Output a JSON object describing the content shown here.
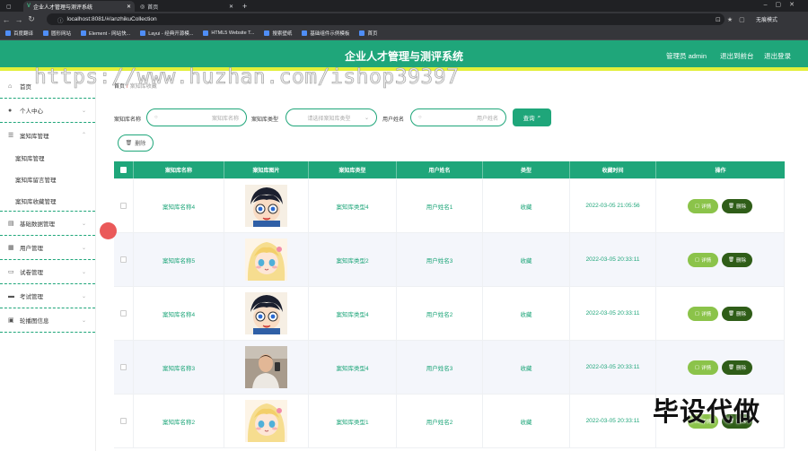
{
  "browser": {
    "tabs": [
      {
        "title": "企业人才管理与测评系统",
        "active": true
      },
      {
        "title": "首页",
        "active": false
      }
    ],
    "url": "localhost:8081/#/anzhikuCollection",
    "bookmarks": [
      "百度翻译",
      "圆形网站",
      "Element - 网站快...",
      "Layui - 经典开源模...",
      "HTML5 Website T...",
      "搜索壁纸",
      "基础组件示例模板",
      "首页"
    ],
    "profile": "无痕模式"
  },
  "header": {
    "title": "企业人才管理与测评系统",
    "user": "管理员 admin",
    "back_link": "退出到前台",
    "logout": "退出登录"
  },
  "sidebar": {
    "items": [
      {
        "icon": "home-icon",
        "label": "首页"
      },
      {
        "icon": "person-icon",
        "label": "个人中心"
      },
      {
        "icon": "list-icon",
        "label": "案知库管理"
      }
    ],
    "sub_items": [
      "案知库管理",
      "案知库留言管理",
      "案知库收藏管理"
    ],
    "items_after": [
      {
        "icon": "data-icon",
        "label": "基础数据管理"
      },
      {
        "icon": "user-icon",
        "label": "用户管理"
      },
      {
        "icon": "paper-icon",
        "label": "试卷管理"
      },
      {
        "icon": "exam-icon",
        "label": "考试管理"
      },
      {
        "icon": "image-icon",
        "label": "轮播图信息"
      }
    ]
  },
  "breadcrumb": {
    "home": "首页",
    "sep": "/",
    "current": "案知库收藏"
  },
  "search": {
    "name_label": "案知库名称",
    "name_placeholder": "案知库名称",
    "type_label": "案知库类型",
    "type_placeholder": "请选择案知库类型",
    "user_label": "用户姓名",
    "user_placeholder": "用户姓名",
    "query_button": "查询"
  },
  "batch_delete": "删除",
  "table": {
    "headers": [
      "案知库名称",
      "案知库图片",
      "案知库类型",
      "用户姓名",
      "类型",
      "收藏时间",
      "操作"
    ],
    "rows": [
      {
        "name": "案知库名称4",
        "type": "案知库类型4",
        "user": "用户姓名1",
        "kind": "收藏",
        "time": "2022-03-05 21:05:56",
        "img": "anime-boy-glasses"
      },
      {
        "name": "案知库名称5",
        "type": "案知库类型2",
        "user": "用户姓名3",
        "kind": "收藏",
        "time": "2022-03-05 20:33:11",
        "img": "anime-girl-blonde"
      },
      {
        "name": "案知库名称4",
        "type": "案知库类型4",
        "user": "用户姓名2",
        "kind": "收藏",
        "time": "2022-03-05 20:33:11",
        "img": "anime-boy-glasses"
      },
      {
        "name": "案知库名称3",
        "type": "案知库类型4",
        "user": "用户姓名3",
        "kind": "收藏",
        "time": "2022-03-05 20:33:11",
        "img": "person-photo"
      },
      {
        "name": "案知库名称2",
        "type": "案知库类型1",
        "user": "用户姓名2",
        "kind": "收藏",
        "time": "2022-03-05 20:33:11",
        "img": "anime-girl-blonde"
      }
    ],
    "detail_button": "详情",
    "delete_button": "删除"
  },
  "overlay": {
    "watermark": "https://www.huzhan.com/ishop39397",
    "promo": "毕设代做"
  }
}
